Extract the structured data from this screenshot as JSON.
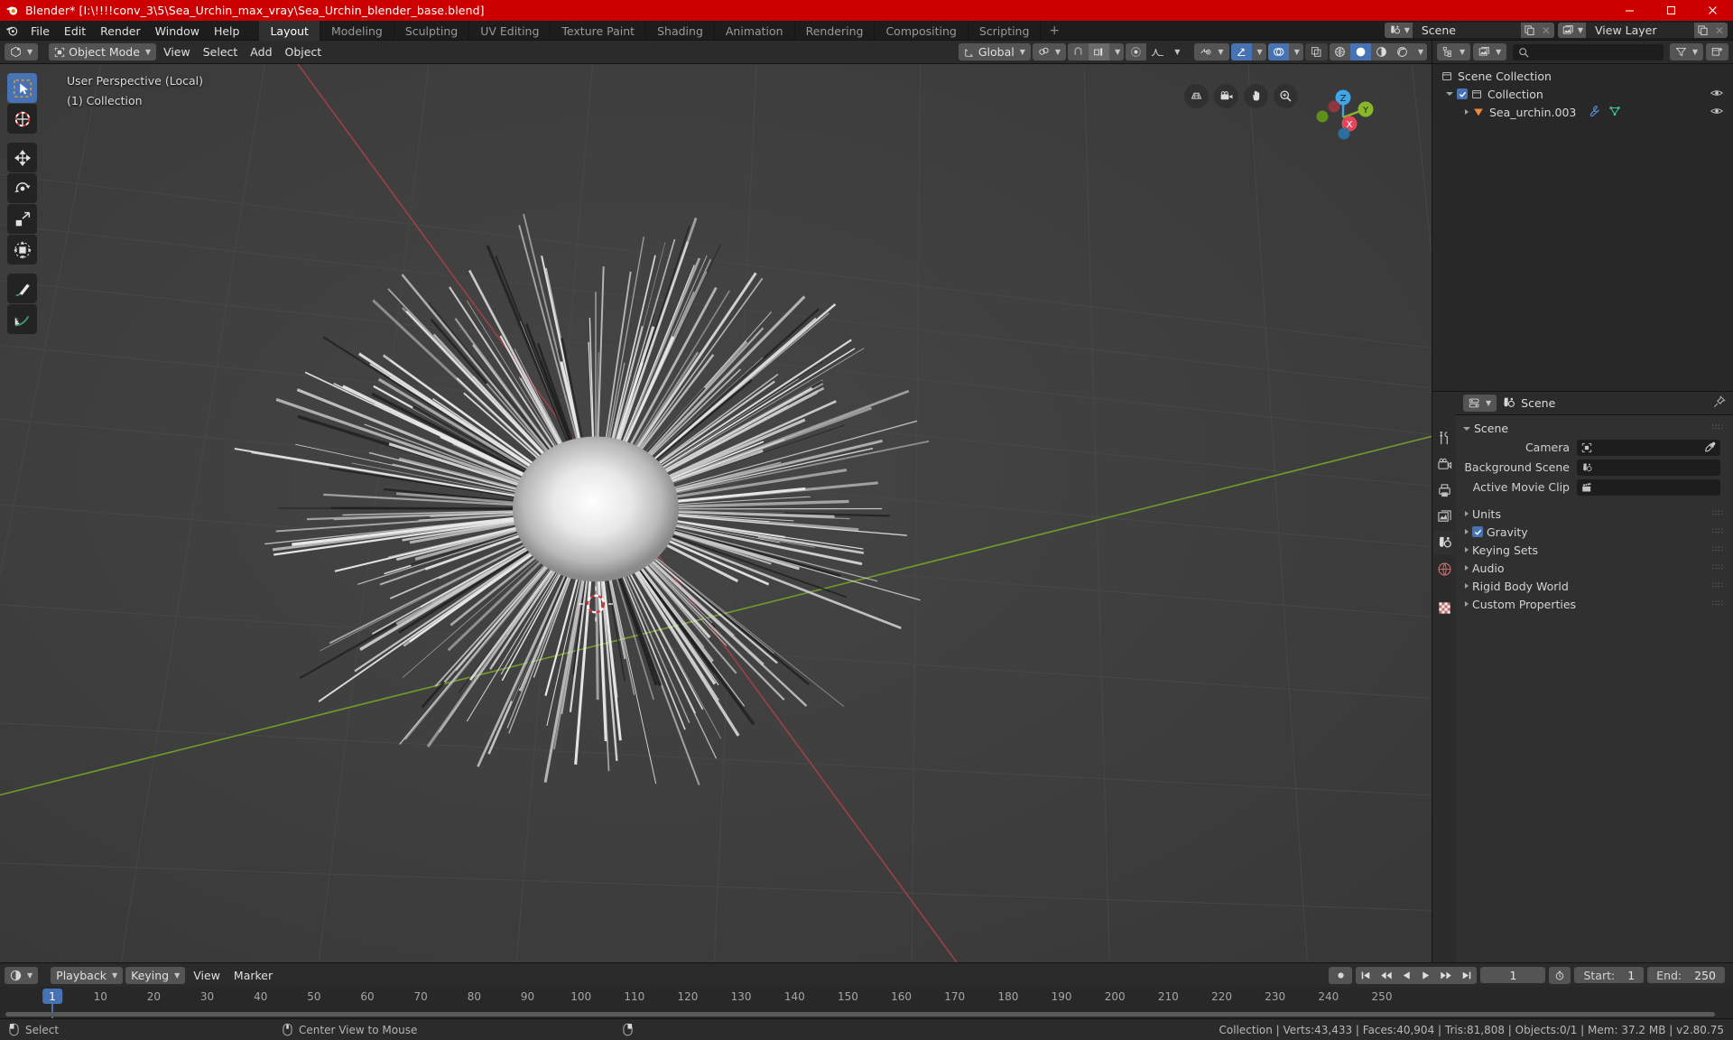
{
  "window": {
    "title": "Blender* [I:\\!!!!conv_3\\5\\Sea_Urchin_max_vray\\Sea_Urchin_blender_base.blend]",
    "logo_icon": "blender-logo-icon",
    "minimize_icon": "minimize-icon",
    "maximize_icon": "maximize-icon",
    "close_icon": "close-icon",
    "titlebar_color": "#cc0000"
  },
  "topbar": {
    "app_icon": "blender-icon",
    "menus": [
      "File",
      "Edit",
      "Render",
      "Window",
      "Help"
    ],
    "workspaces": [
      {
        "label": "Layout",
        "active": true
      },
      {
        "label": "Modeling",
        "active": false
      },
      {
        "label": "Sculpting",
        "active": false
      },
      {
        "label": "UV Editing",
        "active": false
      },
      {
        "label": "Texture Paint",
        "active": false
      },
      {
        "label": "Shading",
        "active": false
      },
      {
        "label": "Animation",
        "active": false
      },
      {
        "label": "Rendering",
        "active": false
      },
      {
        "label": "Compositing",
        "active": false
      },
      {
        "label": "Scripting",
        "active": false
      }
    ],
    "add_workspace_label": "+",
    "scene": {
      "icon": "scene-icon",
      "name": "Scene",
      "new_icon": "copy-icon",
      "unlink_icon": "x-icon"
    },
    "view_layer": {
      "icon": "view-layer-icon",
      "name": "View Layer",
      "new_icon": "copy-icon",
      "unlink_icon": "x-icon"
    }
  },
  "viewport": {
    "header": {
      "editor_type_icon": "editor-type-3dview-icon",
      "mode_icon": "object-mode-icon",
      "mode": "Object Mode",
      "menus": [
        "View",
        "Select",
        "Add",
        "Object"
      ],
      "transform_orientation_icon": "orientation-icon",
      "transform_orientation": "Global",
      "snap_icon": "magnet-icon",
      "snap_target_icon": "snap-increment-icon",
      "proportional_icon": "proportional-edit-icon",
      "falloff_icon": "smooth-falloff-icon",
      "visibility_icon": "object-visibility-icon",
      "gizmo_icon": "gizmo-icon",
      "overlays_icon": "overlays-icon",
      "xray_icon": "xray-icon",
      "shading_modes": [
        "wireframe",
        "solid",
        "material-preview",
        "rendered"
      ],
      "shading_active": "solid"
    },
    "overlay_text": {
      "line1": "User Perspective (Local)",
      "line2": "(1) Collection"
    },
    "toolbar": [
      {
        "name": "tweak-select-box-tool",
        "active": true
      },
      {
        "name": "cursor-tool",
        "active": false
      },
      {
        "name": "move-tool",
        "active": false
      },
      {
        "name": "rotate-tool",
        "active": false
      },
      {
        "name": "scale-tool",
        "active": false
      },
      {
        "name": "transform-tool",
        "active": false
      },
      {
        "name": "annotate-tool",
        "active": false
      },
      {
        "name": "measure-tool",
        "active": false
      }
    ],
    "nav_buttons": [
      "orthographic-toggle-icon",
      "camera-view-icon",
      "pan-view-icon",
      "zoom-view-icon"
    ],
    "gizmo_axes": [
      "X",
      "Y",
      "Z"
    ],
    "scene_object": "Sea urchin model with radiating white spines"
  },
  "outliner": {
    "header": {
      "editor_type_icon": "editor-type-outliner-icon",
      "display_mode_icon": "view-layer-icon",
      "search_icon": "search-icon",
      "search_value": "",
      "filter_icon": "filter-icon",
      "new_collection_icon": "new-collection-icon"
    },
    "rows": [
      {
        "label": "Scene Collection",
        "icon": "scene-collection-icon",
        "indent": 0,
        "disclosure": "none",
        "checkbox": false,
        "eye": false
      },
      {
        "label": "Collection",
        "icon": "collection-icon",
        "indent": 1,
        "disclosure": "down",
        "checkbox": true,
        "eye": true
      },
      {
        "label": "Sea_urchin.003",
        "icon": "mesh-object-icon",
        "indent": 2,
        "disclosure": "right",
        "checkbox": false,
        "eye": true,
        "extra_icons": [
          "modifier-wrench-icon",
          "mesh-data-icon"
        ]
      }
    ]
  },
  "properties": {
    "tabs": [
      {
        "name": "tool",
        "icon": "tool-icon",
        "active": false
      },
      {
        "name": "render",
        "icon": "render-camera-icon",
        "active": false
      },
      {
        "name": "output",
        "icon": "output-printer-icon",
        "active": false
      },
      {
        "name": "view-layer",
        "icon": "view-layer-images-icon",
        "active": false
      },
      {
        "name": "scene",
        "icon": "scene-icon",
        "active": true
      },
      {
        "name": "world",
        "icon": "world-globe-icon",
        "active": false
      },
      {
        "name": "texture",
        "icon": "texture-checker-icon",
        "active": false
      }
    ],
    "header": {
      "editor_type_icon": "editor-type-properties-icon",
      "breadcrumb_icon": "scene-icon",
      "breadcrumb": "Scene",
      "pin_icon": "pin-icon"
    },
    "panel": {
      "title": "Scene",
      "fields": [
        {
          "label": "Camera",
          "icon": "camera-object-icon",
          "value": "",
          "has_eyedropper": true
        },
        {
          "label": "Background Scene",
          "icon": "scene-icon",
          "value": "",
          "has_eyedropper": false
        },
        {
          "label": "Active Movie Clip",
          "icon": "movie-clip-icon",
          "value": "",
          "has_eyedropper": false
        }
      ]
    },
    "sections": [
      {
        "label": "Units",
        "checkbox": null
      },
      {
        "label": "Gravity",
        "checkbox": true
      },
      {
        "label": "Keying Sets",
        "checkbox": null
      },
      {
        "label": "Audio",
        "checkbox": null
      },
      {
        "label": "Rigid Body World",
        "checkbox": null
      },
      {
        "label": "Custom Properties",
        "checkbox": null
      }
    ]
  },
  "timeline": {
    "header": {
      "editor_type_icon": "editor-type-timeline-icon",
      "menus": [
        "Playback",
        "Keying",
        "View",
        "Marker"
      ],
      "record_icon": "auto-keying-icon",
      "transport": [
        "jump-to-start-icon",
        "previous-keyframe-icon",
        "play-reverse-icon",
        "play-icon",
        "next-keyframe-icon",
        "jump-to-end-icon"
      ],
      "current_frame": "1",
      "stopwatch_icon": "use-preview-range-icon",
      "start_label": "Start:",
      "start_value": "1",
      "end_label": "End:",
      "end_value": "250"
    },
    "ruler_ticks": [
      10,
      20,
      30,
      40,
      50,
      60,
      70,
      80,
      90,
      100,
      110,
      120,
      130,
      140,
      150,
      160,
      170,
      180,
      190,
      200,
      210,
      220,
      230,
      240,
      250
    ],
    "playhead_frame": "1"
  },
  "statusbar": {
    "left_items": [
      {
        "icon": "mouse-left-icon",
        "label": "Select"
      },
      {
        "icon": "mouse-middle-icon",
        "label": "Center View to Mouse"
      },
      {
        "icon": "mouse-right-icon",
        "label": ""
      }
    ],
    "stats": "Collection | Verts:43,433 | Faces:40,904 | Tris:81,808 | Objects:0/1 | Mem: 37.2 MB | v2.80.75"
  },
  "colors": {
    "accent_blue": "#4772b3",
    "title_red": "#cc0000",
    "axis_x_red": "#a33b3b",
    "axis_y_green": "#7c9c2e",
    "viewport_bg": "#3b3b3b"
  }
}
